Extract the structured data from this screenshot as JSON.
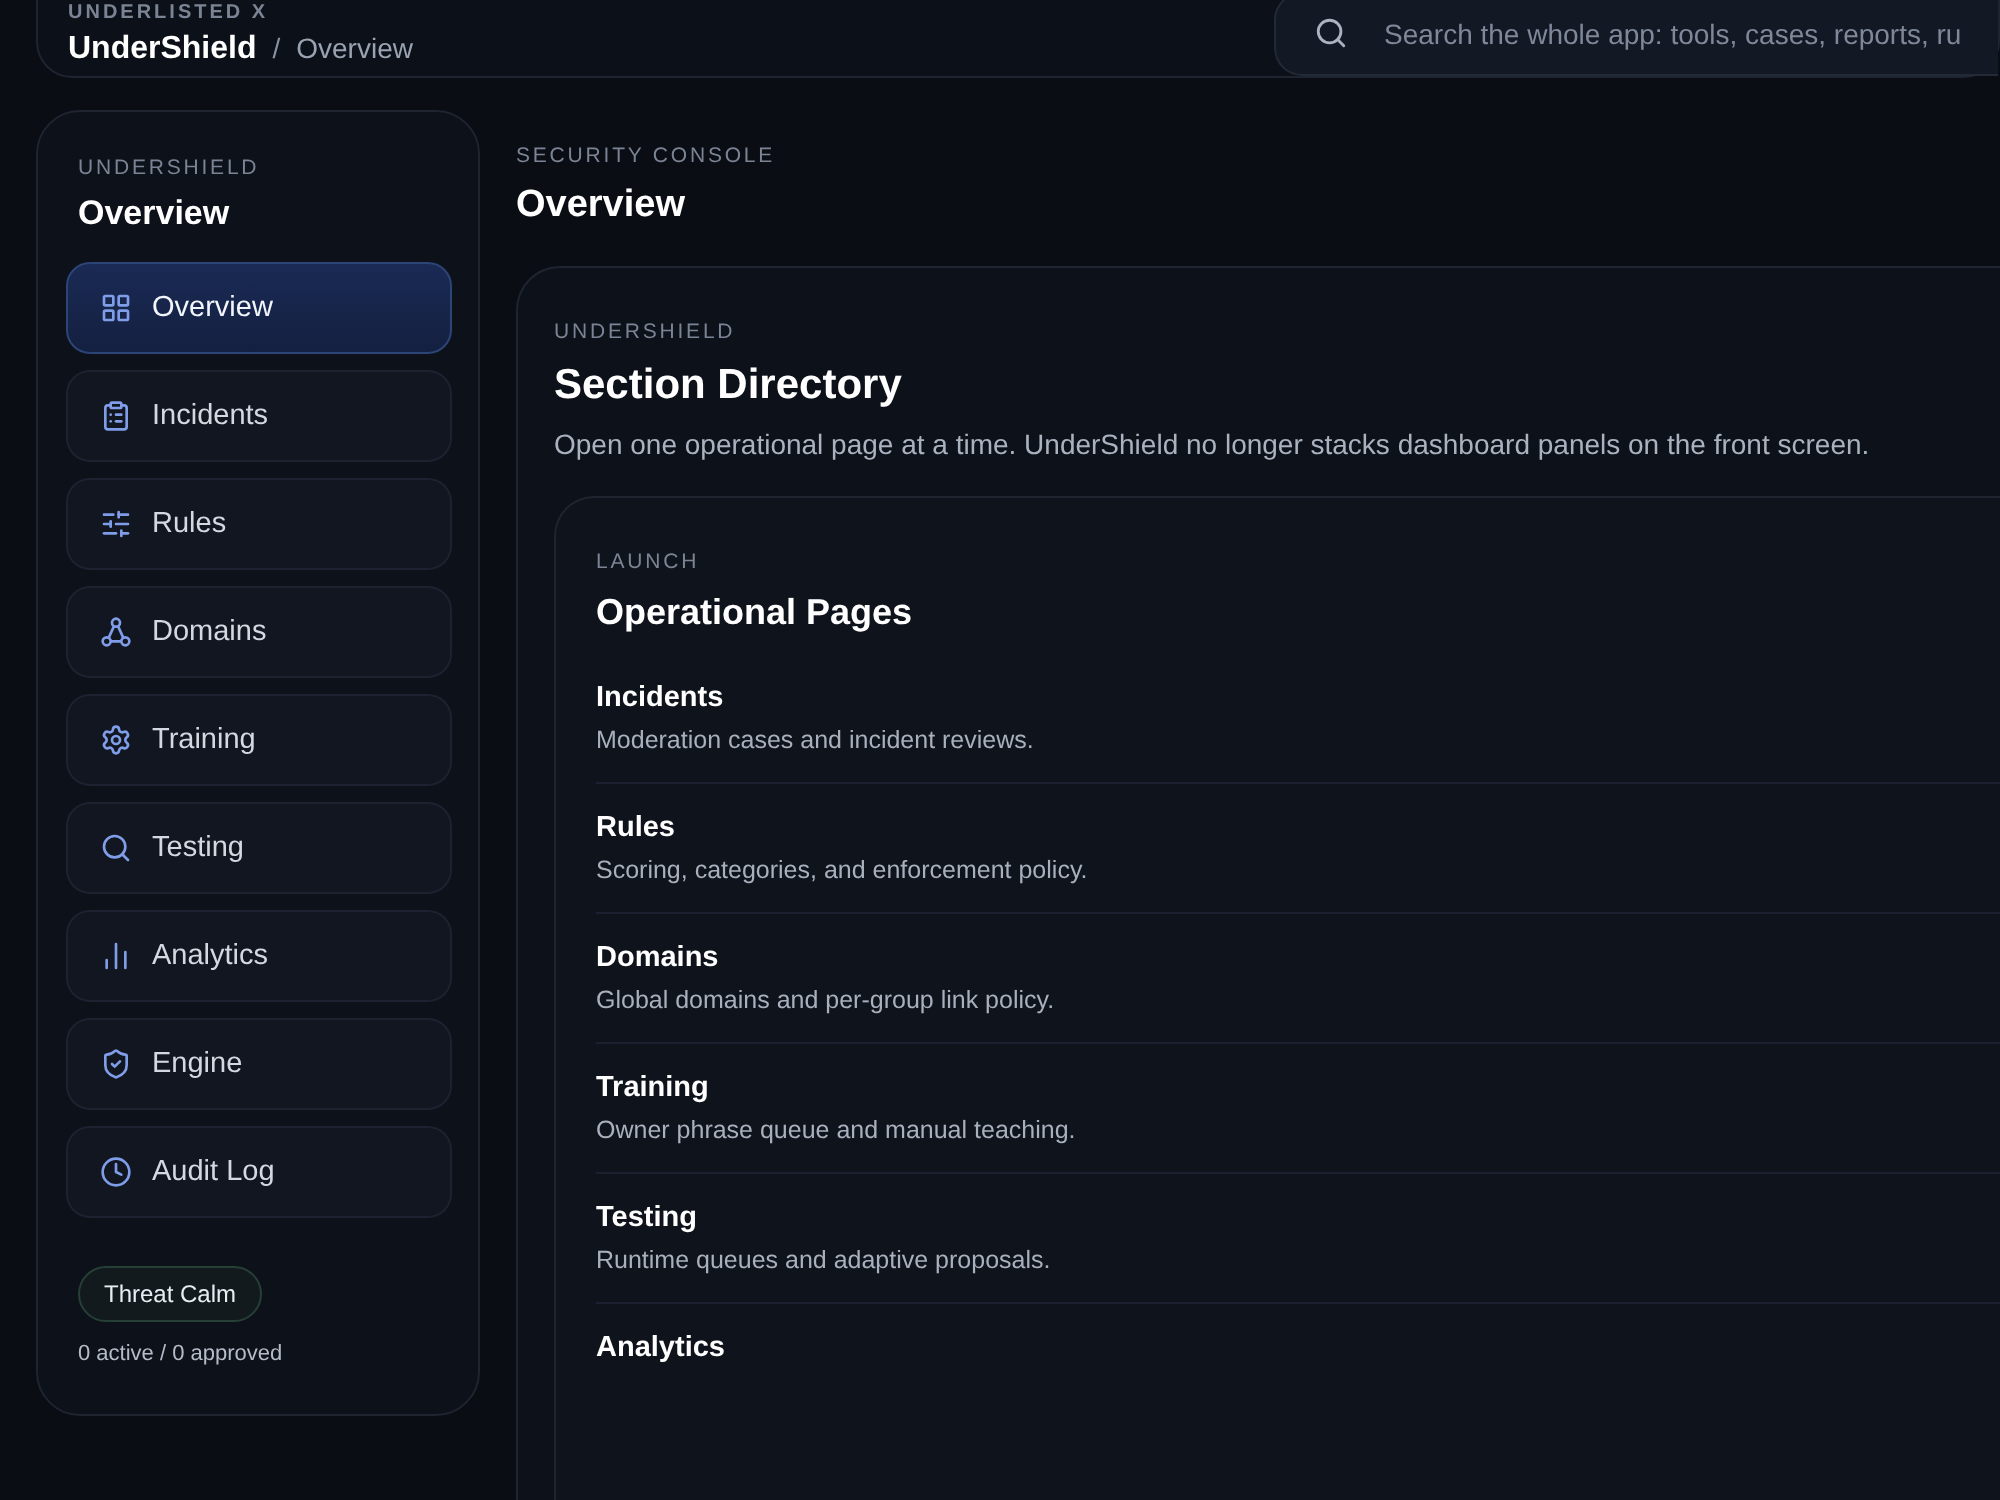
{
  "header": {
    "eyebrow": "UNDERLISTED X",
    "brand": "UnderShield",
    "separator": "/",
    "crumb": "Overview",
    "search": {
      "placeholder": "Search the whole app: tools, cases, reports, ru"
    }
  },
  "sidebar": {
    "eyebrow": "UNDERSHIELD",
    "title": "Overview",
    "items": [
      {
        "label": "Overview",
        "selected": true
      },
      {
        "label": "Incidents",
        "selected": false
      },
      {
        "label": "Rules",
        "selected": false
      },
      {
        "label": "Domains",
        "selected": false
      },
      {
        "label": "Training",
        "selected": false
      },
      {
        "label": "Testing",
        "selected": false
      },
      {
        "label": "Analytics",
        "selected": false
      },
      {
        "label": "Engine",
        "selected": false
      },
      {
        "label": "Audit Log",
        "selected": false
      }
    ],
    "status_badge": "Threat Calm",
    "status_text": "0 active / 0 approved"
  },
  "main": {
    "eyebrow": "SECURITY CONSOLE",
    "title": "Overview",
    "directory": {
      "eyebrow": "UNDERSHIELD",
      "title": "Section Directory",
      "description": "Open one operational page at a time. UnderShield no longer stacks dashboard panels on the front screen.",
      "launch": {
        "eyebrow": "LAUNCH",
        "title": "Operational Pages",
        "pages": [
          {
            "title": "Incidents",
            "description": "Moderation cases and incident reviews."
          },
          {
            "title": "Rules",
            "description": "Scoring, categories, and enforcement policy."
          },
          {
            "title": "Domains",
            "description": "Global domains and per-group link policy."
          },
          {
            "title": "Training",
            "description": "Owner phrase queue and manual teaching."
          },
          {
            "title": "Testing",
            "description": "Runtime queues and adaptive proposals."
          },
          {
            "title": "Analytics"
          }
        ]
      }
    }
  }
}
